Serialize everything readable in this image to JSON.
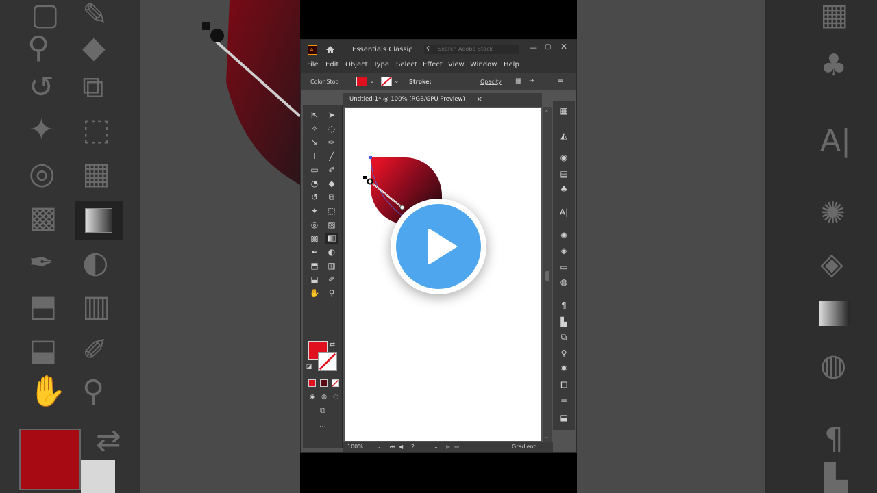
{
  "app": {
    "logo": "Ai",
    "workspace": "Essentials Classic",
    "search_placeholder": "Search Adobe Stock"
  },
  "menu": [
    "File",
    "Edit",
    "Object",
    "Type",
    "Select",
    "Effect",
    "View",
    "Window",
    "Help"
  ],
  "controlbar": {
    "label": "Color Stop",
    "stroke_label": "Stroke:",
    "opacity_label": "Opacity"
  },
  "document_tab": {
    "title": "Untitled-1* @ 100% (RGB/GPU Preview)",
    "close": "×"
  },
  "status": {
    "zoom": "100%",
    "artboard_number": "2",
    "tool_name": "Gradient"
  },
  "colors": {
    "fill": "#e0101e",
    "shape_light": "#e01225",
    "shape_dark": "#2a0a12",
    "play_blue": "#4ea6ee"
  },
  "icons": {
    "home": "home-icon",
    "play": "play-icon"
  }
}
